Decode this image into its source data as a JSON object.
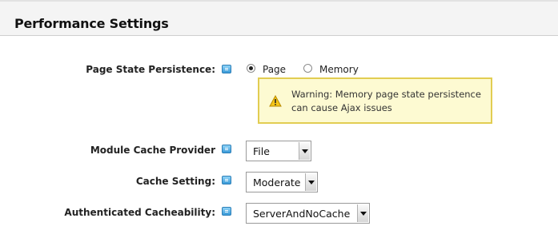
{
  "header": {
    "title": "Performance Settings"
  },
  "settings": {
    "page_state": {
      "label": "Page State Persistence:",
      "options": [
        {
          "label": "Page",
          "checked": true
        },
        {
          "label": "Memory",
          "checked": false
        }
      ],
      "warning": "Warning: Memory page state persistence can cause Ajax issues"
    },
    "module_cache": {
      "label": "Module Cache Provider",
      "value": "File"
    },
    "cache_setting": {
      "label": "Cache Setting:",
      "value": "Moderate"
    },
    "authenticated": {
      "label": "Authenticated Cacheability:",
      "value": "ServerAndNoCache"
    }
  }
}
